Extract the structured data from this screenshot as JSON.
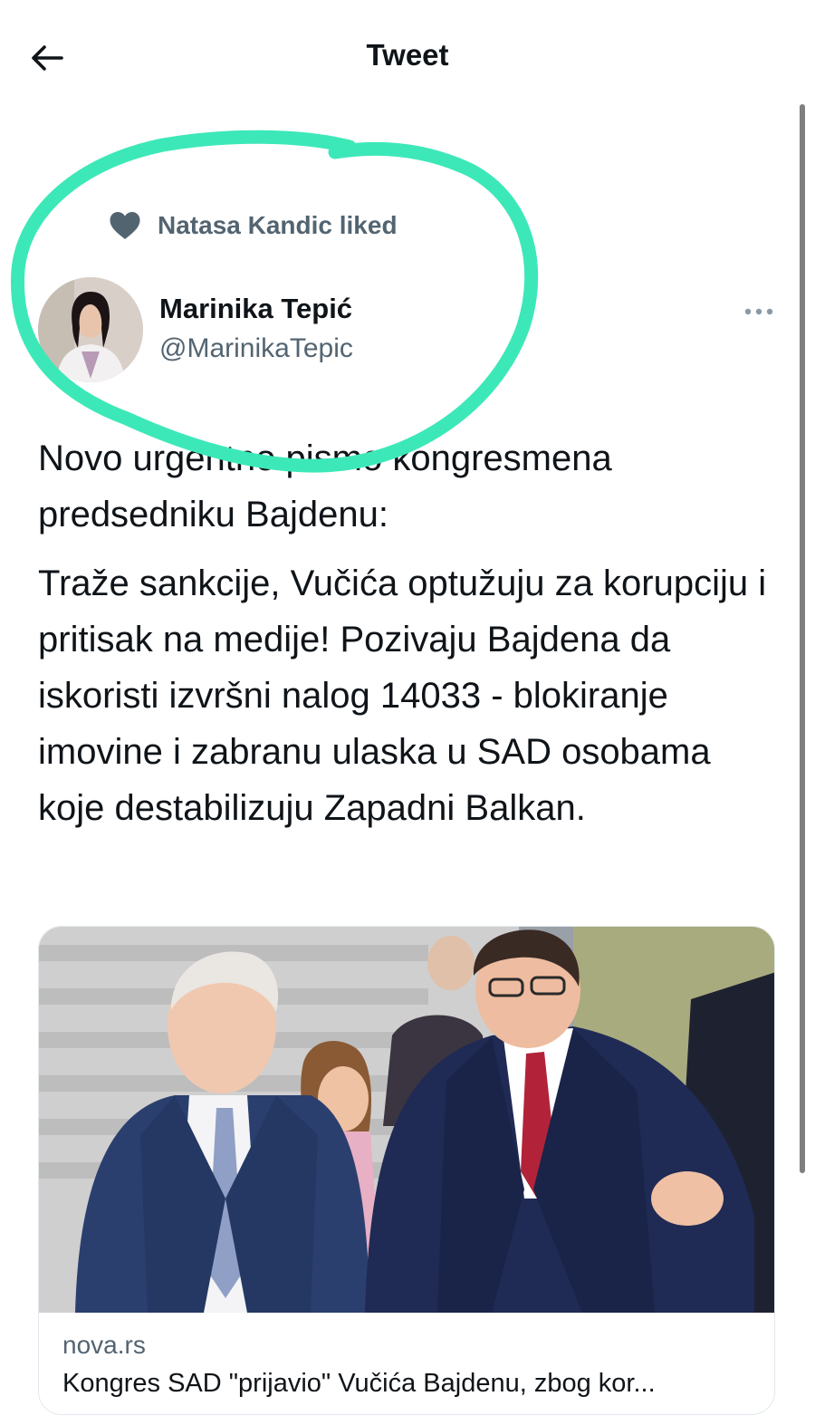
{
  "header": {
    "title": "Tweet",
    "back_icon": "arrow-left-icon"
  },
  "social_context": {
    "icon": "heart-icon",
    "text": "Natasa Kandic liked"
  },
  "author": {
    "name": "Marinika Tepić",
    "handle": "@MarinikaTepic"
  },
  "tweet": {
    "paragraphs": [
      "Novo urgentno pismo kongresmena predsedniku Bajdenu:",
      "Traže sankcije, Vučića optužuju za korupciju i pritisak na medije! Pozivaju Bajdena da iskoristi izvršni nalog 14033 - blokiranje imovine i zabranu ulaska u SAD osobama koje destabilizuju Zapadni Balkan."
    ]
  },
  "link_card": {
    "domain": "nova.rs",
    "title": "Kongres SAD \"prijavio\" Vučića Bajdenu, zbog kor..."
  },
  "colors": {
    "text_primary": "#0f1419",
    "text_secondary": "#536471",
    "annotation": "#3de8b8",
    "border": "#e1e8ed"
  }
}
